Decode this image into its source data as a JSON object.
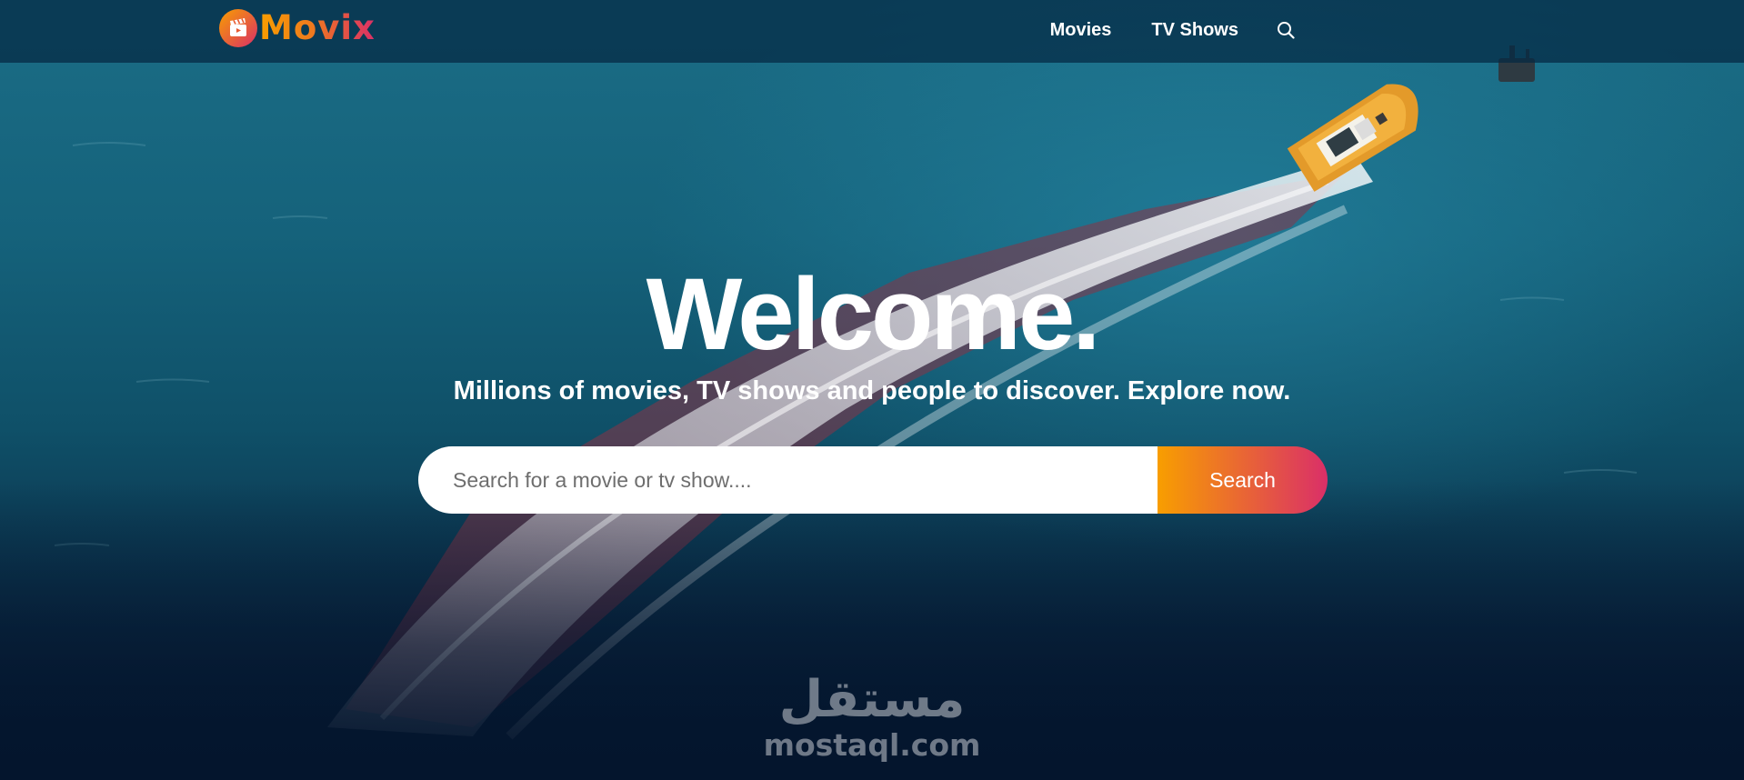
{
  "app": {
    "logo_text": "Movix",
    "brand_gradient": [
      "#f89e00",
      "#da2f68"
    ],
    "background_color": "#04152d"
  },
  "header": {
    "nav": [
      {
        "label": "Movies"
      },
      {
        "label": "TV Shows"
      }
    ],
    "search_icon": "search-icon"
  },
  "hero": {
    "title": "Welcome.",
    "subtitle": "Millions of movies, TV shows and people to discover. Explore now.",
    "background_image": "aerial view of an orange tugboat with white wake over blue ocean"
  },
  "search": {
    "placeholder": "Search for a movie or tv show....",
    "value": "",
    "button_label": "Search"
  },
  "watermark": {
    "arabic": "مستقل",
    "latin": "mostaql.com"
  }
}
